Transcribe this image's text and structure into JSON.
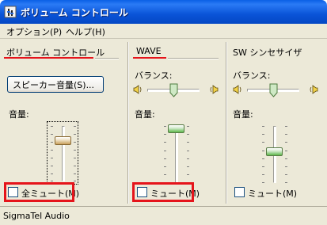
{
  "window": {
    "title": "ボリューム コントロール"
  },
  "menu": [
    {
      "label": "オプション(P)"
    },
    {
      "label": "ヘルプ(H)"
    }
  ],
  "columns": [
    {
      "title": "ボリューム コントロール",
      "button_label": "スピーカー音量(S)...",
      "volume_label": "音量:",
      "volume_level": 0.65,
      "mute_label": "全ミュート(M)",
      "mute_checked": false
    },
    {
      "title": "WAVE",
      "balance_label": "バランス:",
      "volume_label": "音量:",
      "volume_level": 0.95,
      "mute_label": "ミュート(M)",
      "mute_checked": false
    },
    {
      "title": "SW シンセサイザ",
      "balance_label": "バランス:",
      "volume_label": "音量:",
      "volume_level": 0.55,
      "mute_label": "ミュート(M)",
      "mute_checked": false
    }
  ],
  "status": {
    "text": "SigmaTel Audio"
  },
  "colors": {
    "highlight": "#e5141b",
    "titlebar": "#0a54d8",
    "face": "#ece9d8"
  }
}
